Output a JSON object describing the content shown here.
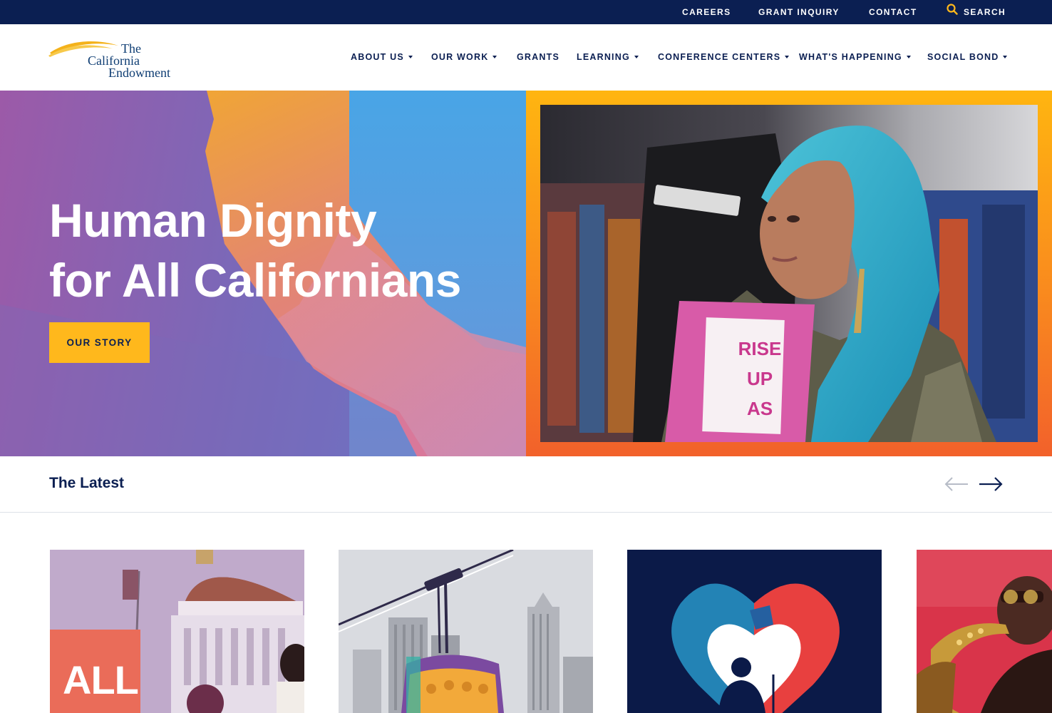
{
  "utility_nav": {
    "careers": "CAREERS",
    "grant_inquiry": "GRANT INQUIRY",
    "contact": "CONTACT",
    "search": "SEARCH"
  },
  "logo": {
    "line1": "The",
    "line2": "California",
    "line3": "Endowment"
  },
  "main_nav": {
    "about_us": "ABOUT US",
    "our_work": "OUR WORK",
    "grants": "GRANTS",
    "learning": "LEARNING",
    "conference_centers": "CONFERENCE CENTERS",
    "whats_happening": "WHAT'S HAPPENING",
    "social_bond": "SOCIAL BOND"
  },
  "hero": {
    "title_line1": "Human Dignity",
    "title_line2": "for All Californians",
    "cta": "OUR STORY",
    "sign_text_1": "RISE",
    "sign_text_2": "UP",
    "sign_text_3": "AS"
  },
  "latest": {
    "title": "The Latest"
  },
  "cards": {
    "card1_text": "ALL"
  },
  "colors": {
    "navy": "#0b1f52",
    "gold": "#ffb81c",
    "orange": "#f2612b",
    "teal": "#1fa6c9"
  }
}
